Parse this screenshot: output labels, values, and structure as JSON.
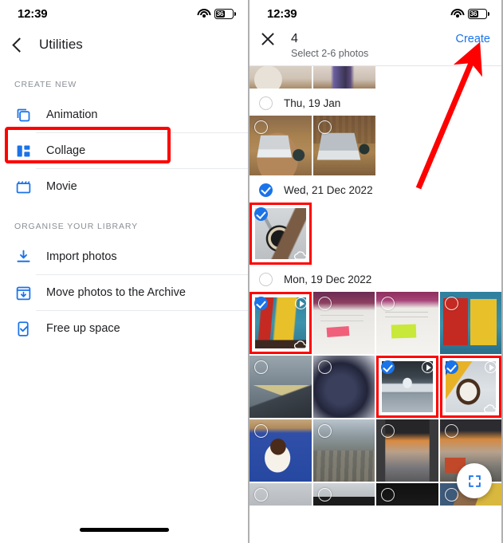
{
  "left_phone": {
    "status_bar": {
      "time": "12:39",
      "battery_level": "36",
      "wifi_icon": "wifi-icon",
      "battery_icon": "battery-icon"
    },
    "nav": {
      "back_icon": "back-chevron-icon",
      "title": "Utilities"
    },
    "sections": [
      {
        "label": "CREATE NEW",
        "items": [
          {
            "label": "Animation",
            "icon": "animation-icon"
          },
          {
            "label": "Collage",
            "icon": "collage-icon",
            "highlighted": true
          },
          {
            "label": "Movie",
            "icon": "movie-icon"
          }
        ]
      },
      {
        "label": "ORGANISE YOUR LIBRARY",
        "items": [
          {
            "label": "Import photos",
            "icon": "import-download-icon"
          },
          {
            "label": "Move photos to the Archive",
            "icon": "archive-box-icon"
          },
          {
            "label": "Free up space",
            "icon": "free-up-space-icon"
          }
        ]
      }
    ],
    "home_indicator": "home-indicator"
  },
  "right_phone": {
    "status_bar": {
      "time": "12:39",
      "battery_level": "36",
      "wifi_icon": "wifi-icon",
      "battery_icon": "battery-icon"
    },
    "picker_header": {
      "close_icon": "close-x-icon",
      "selected_count": "4",
      "create_label": "Create",
      "subtitle": "Select 2-6 photos"
    },
    "date_groups": [
      {
        "date": "Thu, 19 Jan",
        "checked": false
      },
      {
        "date": "Wed, 21 Dec 2022",
        "checked": true
      },
      {
        "date": "Mon, 19 Dec 2022",
        "checked": false
      }
    ],
    "fab": {
      "icon": "fullscreen-expand-icon"
    }
  },
  "annotations": {
    "highlight_color": "#ff0000",
    "arrow_icon": "red-arrow-pointing-to-create",
    "highlighted_items": [
      "Collage",
      "watch-photo",
      "books-video",
      "metro-video",
      "icecream-video"
    ]
  },
  "colors": {
    "accent_blue": "#1a73e8",
    "text_primary": "#202124",
    "text_secondary": "#5f6368",
    "highlight_red": "#ff0000"
  }
}
